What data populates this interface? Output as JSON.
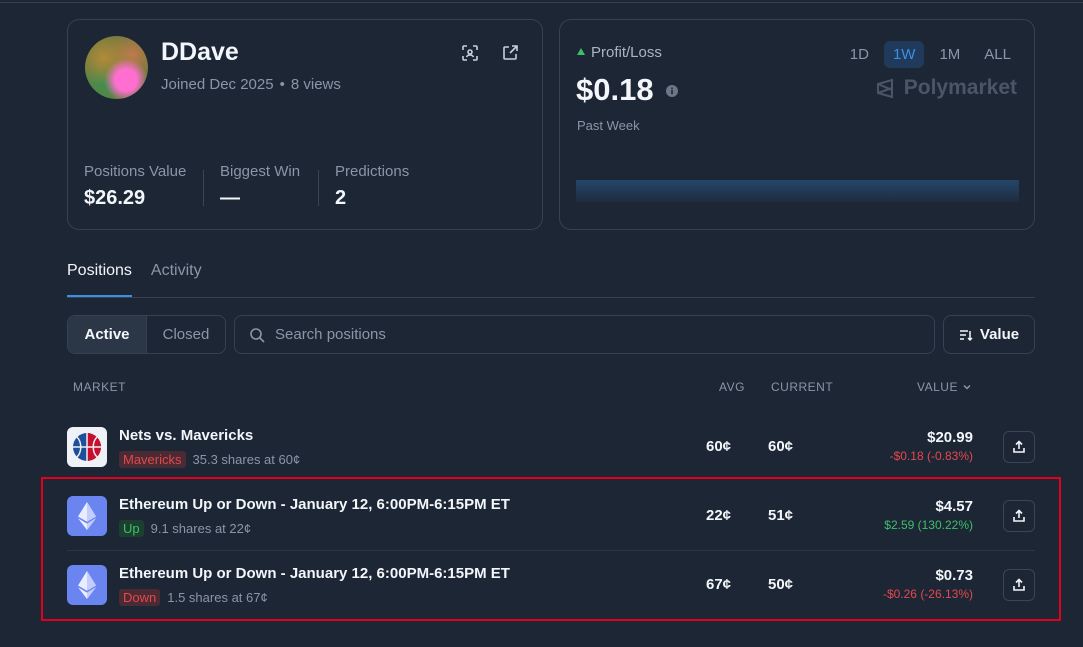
{
  "profile": {
    "username": "DDave",
    "joined": "Joined Dec 2025",
    "views": "8 views",
    "stats": [
      {
        "label": "Positions Value",
        "value": "$26.29"
      },
      {
        "label": "Biggest Win",
        "value": "—"
      },
      {
        "label": "Predictions",
        "value": "2"
      }
    ]
  },
  "pnl": {
    "label": "Profit/Loss",
    "value": "$0.18",
    "sub": "Past Week",
    "ranges": [
      "1D",
      "1W",
      "1M",
      "ALL"
    ],
    "active_range": "1W",
    "brand": "Polymarket"
  },
  "tabs": [
    "Positions",
    "Activity"
  ],
  "filters": {
    "active": "Active",
    "closed": "Closed",
    "search_placeholder": "Search positions",
    "sort_label": "Value"
  },
  "table": {
    "headers": {
      "market": "MARKET",
      "avg": "AVG",
      "current": "CURRENT",
      "value": "VALUE"
    },
    "rows": [
      {
        "icon": "basketball-icon",
        "title": "Nets vs. Mavericks",
        "outcome": "Mavericks",
        "outcome_color": "#e5484d",
        "shares": "35.3 shares at 60¢",
        "avg": "60¢",
        "current": "60¢",
        "value": "$20.99",
        "change": "-$0.18 (-0.83%)"
      },
      {
        "icon": "ethereum-icon",
        "title": "Ethereum Up or Down - January 12, 6:00PM-6:15PM ET",
        "outcome": "Up",
        "outcome_color": "#3cc06a",
        "shares": "9.1 shares at 22¢",
        "avg": "22¢",
        "current": "51¢",
        "value": "$4.57",
        "change": "$2.59 (130.22%)"
      },
      {
        "icon": "ethereum-icon",
        "title": "Ethereum Up or Down - January 12, 6:00PM-6:15PM ET",
        "outcome": "Down",
        "outcome_color": "#e5484d",
        "shares": "1.5 shares at 67¢",
        "avg": "67¢",
        "current": "50¢",
        "value": "$0.73",
        "change": "-$0.26 (-26.13%)"
      }
    ]
  },
  "colors": {
    "accent": "#3d8fe6",
    "positive": "#3cc06a",
    "negative": "#e5484d",
    "highlight_box": "#e3001b"
  }
}
